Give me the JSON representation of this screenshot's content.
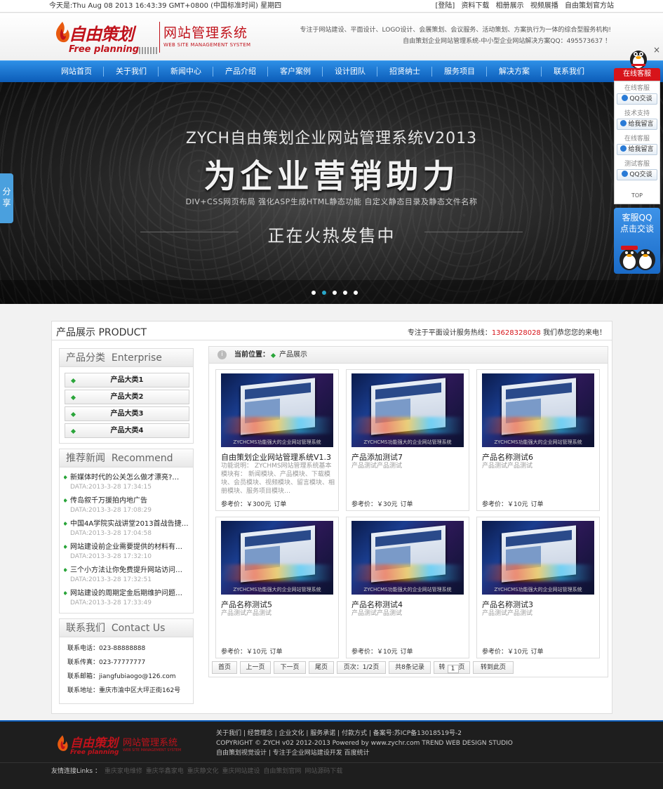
{
  "topbar": {
    "date": "今天是:Thu Aug 08 2013 16:43:39 GMT+0800 (中国标准时间) 星期四",
    "links": [
      "[登陆]",
      "资料下载",
      "相册展示",
      "视频展播",
      "自由策划官方站"
    ]
  },
  "header": {
    "logo_cn": "自由策划",
    "logo_en": "Free planning",
    "system_cn": "网站管理系统",
    "system_en": "WEB SITE MANAGEMENT SYSTEM",
    "slogan_line1": "专注于网站建设、平面设计、LOGO设计、会展策划、会议服务、活动策划、方案执行为一体的综合型服务机构!",
    "slogan_line2": "自由策划企业网站管理系统-中小型企业网站解决方案QQ：495573637 ！"
  },
  "nav": {
    "items": [
      "网站首页",
      "关于我们",
      "新闻中心",
      "产品介绍",
      "客户案例",
      "设计团队",
      "招贤纳士",
      "服务项目",
      "解决方案",
      "联系我们"
    ]
  },
  "banner": {
    "line1": "ZYCH自由策划企业网站管理系统V2013",
    "line2": "为企业营销助力",
    "line3": "DIV+CSS网页布局    强化ASP生成HTML静态功能    自定义静态目录及静态文件名称",
    "line4": "正在火热发售中",
    "dots": 5,
    "active_dot": 1
  },
  "share": {
    "label": "分享"
  },
  "kefu": {
    "close": "×",
    "title": "在线客服",
    "items": [
      {
        "label": "在线客服",
        "button": "QQ交谈"
      },
      {
        "label": "技术支持",
        "button": "给我留言"
      },
      {
        "label": "在线客服",
        "button": "给我留言"
      },
      {
        "label": "测试客服",
        "button": "QQ交谈"
      }
    ],
    "top": "TOP",
    "qq_line1": "客服QQ",
    "qq_line2": "点击交谈"
  },
  "main": {
    "title": "产品展示 PRODUCT",
    "hotline_prefix": "专注于平面设计服务热线：",
    "hotline_tel": "13628328028",
    "hotline_suffix": " 我们恭您您的来电！"
  },
  "category": {
    "title": "产品分类",
    "title_en": "Enterprise",
    "items": [
      "产品大类1",
      "产品大类2",
      "产品大类3",
      "产品大类4"
    ]
  },
  "recommend": {
    "title": "推荐新闻",
    "title_en": "Recommend",
    "items": [
      {
        "title": "新媒体时代的公关怎么做才漂亮?…",
        "date": "DATA:2013-3-28 17:34:15"
      },
      {
        "title": "传岛叙千万援拍内地广告",
        "date": "DATA:2013-3-28 17:08:29"
      },
      {
        "title": "中国4A学院实战讲堂2013首战告捷…",
        "date": "DATA:2013-3-28 17:04:58"
      },
      {
        "title": "网站建设前企业需要提供的材料有…",
        "date": "DATA:2013-3-28 17:32:10"
      },
      {
        "title": "三个小方法让你免费提升网站访问…",
        "date": "DATA:2013-3-28 17:32:51"
      },
      {
        "title": "网站建设的周期定金后期维护问题…",
        "date": "DATA:2013-3-28 17:33:49"
      }
    ]
  },
  "contact": {
    "title": "联系我们",
    "title_en": "Contact Us",
    "lines": [
      "联系电话：023-88888888",
      "联系传真：023-77777777",
      "联系邮箱：jiangfubiaogo@126.com",
      "联系地址：重庆市渝中区大坪正街162号"
    ]
  },
  "crumb": {
    "label": "当前位置：",
    "current": "产品展示",
    "icon": "i"
  },
  "products": {
    "image_caption": "ZYCHCMS功能强大的企业网站管理系统",
    "price_label": "参考价：",
    "order_label": "订单",
    "items": [
      {
        "name": "自由策划企业网站管理系统V1.3",
        "desc": "功能说明： ZYCHMS网站管理系统基本模块有： 新闻模块、产品模块、下载模块、会员模块、视频模块、留言模块、相册模块、服务项目模块…",
        "price": "￥300元"
      },
      {
        "name": "产品添加测试7",
        "desc": "产品测试产品测试",
        "price": "￥30元"
      },
      {
        "name": "产品名称测试6",
        "desc": "产品测试产品测试",
        "price": "￥10元"
      },
      {
        "name": "产品名称测试5",
        "desc": "产品测试产品测试",
        "price": "￥10元"
      },
      {
        "name": "产品名称测试4",
        "desc": "产品测试产品测试",
        "price": "￥10元"
      },
      {
        "name": "产品名称测试3",
        "desc": "产品测试产品测试",
        "price": "￥10元"
      }
    ]
  },
  "pager": {
    "first": "首页",
    "prev": "上一页",
    "next": "下一页",
    "last": "尾页",
    "pages": "页次：1/2页",
    "total": "共8条记录",
    "goto_prefix": "转",
    "goto_value": "1",
    "goto_suffix": "页",
    "goto_button": "转到此页"
  },
  "footer": {
    "logo_cn": "自由策划",
    "logo_en": "Free planning",
    "system_cn": "网站管理系统",
    "system_en": "WEB SITE MANAGEMENT SYSTEM",
    "line1": "关于我们 | 经营理念 | 企业文化 | 服务承诺 | 付款方式 | 备案号:苏ICP备13018519号-2",
    "line2": "COPYRIGHT © ZYCH v02 2012-2013 Powered by www.zychr.com TREND WEB DESIGN STUDIO",
    "line3": "自由策划视觉设计 | 专注于企业网站建设开发 百度统计",
    "links_label": "友情连接Links ：",
    "links": [
      "重庆家电维修",
      "重庆华鑫家电",
      "重庆静文化",
      "重庆网站建设",
      "自由策划官网",
      "网站源码下载"
    ]
  },
  "colors": {
    "nav": "#0c5cb8",
    "brand_red": "#c0121b",
    "accent_green": "#2aa53a",
    "kefu_red": "#d7141a"
  }
}
